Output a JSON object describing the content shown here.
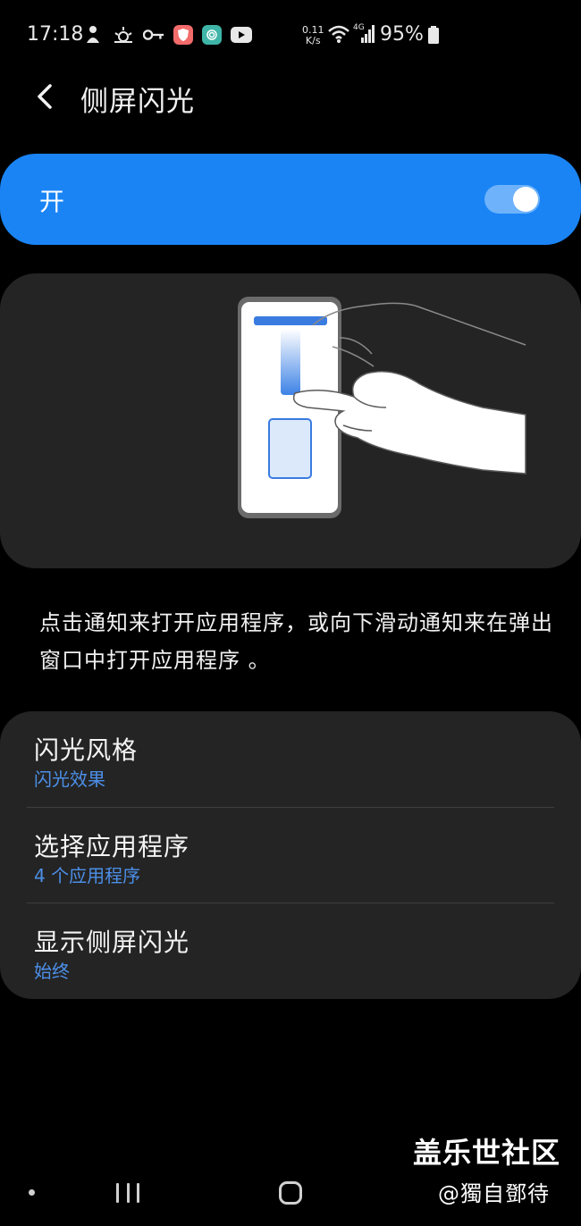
{
  "status_bar": {
    "time": "17:18",
    "net_speed_value": "0.11",
    "net_speed_unit": "K/s",
    "network_type": "4G",
    "battery_percent": "95%",
    "icons_left": [
      "person-icon",
      "weather-icon",
      "key-icon",
      "shield-app-icon",
      "fingerprint-app-icon",
      "youtube-icon"
    ],
    "icons_right": [
      "wifi-icon",
      "signal-icon",
      "battery-icon"
    ]
  },
  "header": {
    "title": "侧屏闪光",
    "back_icon": "chevron-left-icon"
  },
  "master_switch": {
    "label": "开",
    "enabled": true
  },
  "description": "点击通知来打开应用程序，或向下滑动通知来在弹出窗口中打开应用程序 。",
  "settings": [
    {
      "title": "闪光风格",
      "subtitle": "闪光效果"
    },
    {
      "title": "选择应用程序",
      "subtitle": "4 个应用程序"
    },
    {
      "title": "显示侧屏闪光",
      "subtitle": "始终"
    }
  ],
  "watermark": {
    "site": "盖乐世社区",
    "author": "@獨自鄧待"
  },
  "colors": {
    "accent": "#1a84f5",
    "subtitle_blue": "#4c8fe8",
    "card_bg": "#242424",
    "page_bg": "#000000"
  }
}
